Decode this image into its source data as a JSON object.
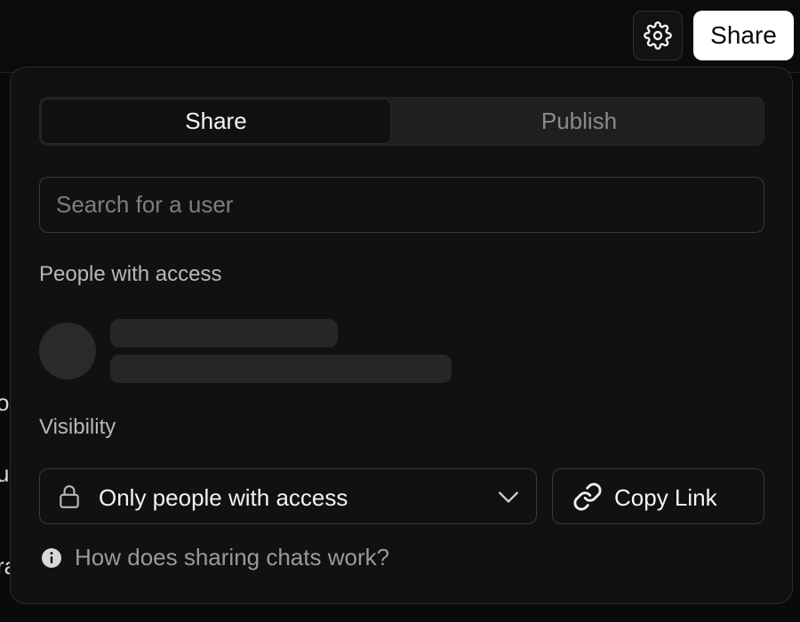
{
  "topbar": {
    "settings_icon": "gear-icon",
    "share_label": "Share"
  },
  "background_fragments": [
    "o",
    "u",
    "ra"
  ],
  "dialog": {
    "tabs": [
      {
        "label": "Share",
        "active": true
      },
      {
        "label": "Publish",
        "active": false
      }
    ],
    "search": {
      "placeholder": "Search for a user",
      "value": ""
    },
    "people_heading": "People with access",
    "visibility_heading": "Visibility",
    "visibility_select": {
      "icon": "lock-icon",
      "selected": "Only people with access",
      "dropdown_icon": "chevron-down-icon"
    },
    "copy_link": {
      "icon": "link-icon",
      "label": "Copy Link"
    },
    "help": {
      "icon": "info-icon",
      "label": "How does sharing chats work?"
    }
  },
  "colors": {
    "background": "#0a0a0a",
    "panel": "#111111",
    "border": "#3a3a3a",
    "skeleton": "#262626",
    "primary_button": "#ffffff"
  }
}
